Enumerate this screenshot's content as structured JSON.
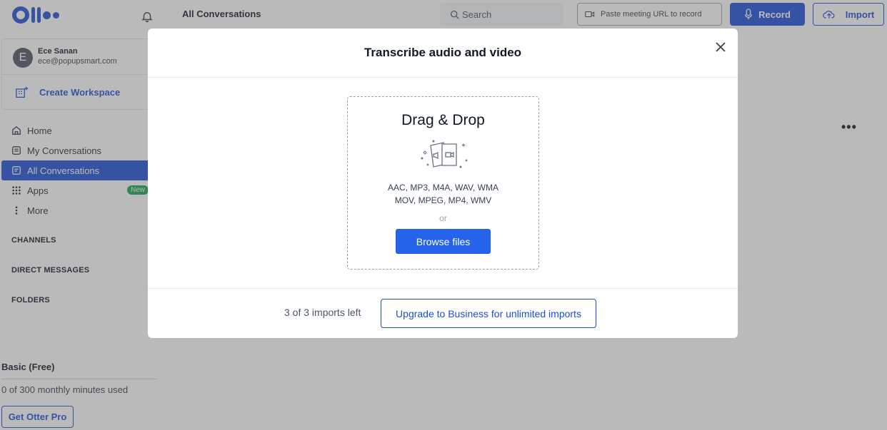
{
  "app": {
    "logo_text": "Otter",
    "colors": {
      "brand": "#1d4ed8",
      "badge_new": "#16a34a"
    }
  },
  "user": {
    "initial": "E",
    "name": "Ece Sanan",
    "email": "ece@popupsmart.com"
  },
  "sidebar": {
    "create_workspace": "Create Workspace",
    "items": [
      {
        "label": "Home",
        "icon": "home-icon"
      },
      {
        "label": "My Conversations",
        "icon": "conversation-icon"
      },
      {
        "label": "All Conversations",
        "icon": "all-conversations-icon",
        "active": true
      },
      {
        "label": "Apps",
        "icon": "apps-grid-icon",
        "badge": "New"
      },
      {
        "label": "More",
        "icon": "more-vertical-icon"
      }
    ],
    "sections": {
      "channels": "CHANNELS",
      "direct_messages": "DIRECT MESSAGES",
      "folders": "FOLDERS"
    },
    "plan": {
      "name": "Basic (Free)",
      "minutes": "0 of 300 monthly minutes used",
      "cta": "Get Otter Pro"
    }
  },
  "header": {
    "title": "All Conversations",
    "search_placeholder": "Search",
    "paste_url": "Paste meeting URL to record",
    "record_label": "Record",
    "import_label": "Import"
  },
  "modal": {
    "title": "Transcribe audio and video",
    "dropzone": {
      "title": "Drag & Drop",
      "formats_line1": "AAC, MP3, M4A, WAV, WMA",
      "formats_line2": "MOV, MPEG, MP4, WMV",
      "or": "or",
      "browse": "Browse files"
    },
    "imports_left": "3 of 3 imports left",
    "upgrade": "Upgrade to Business for unlimited imports"
  }
}
